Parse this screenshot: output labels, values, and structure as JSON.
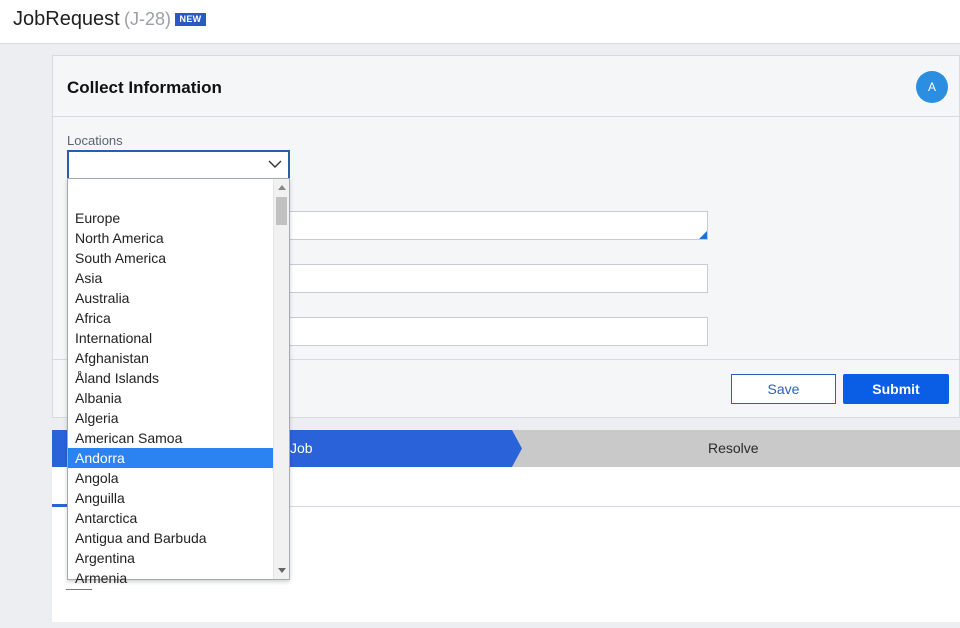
{
  "header": {
    "title": "JobRequest",
    "case_id": "(J-28)",
    "badge": "NEW"
  },
  "card": {
    "title": "Collect Information",
    "avatar_initial": "A",
    "locations_label": "Locations",
    "save_label": "Save",
    "submit_label": "Submit"
  },
  "stages": {
    "active": "Job",
    "next": "Resolve"
  },
  "dropdown": {
    "options": [
      "",
      "Europe",
      "North America",
      "South America",
      "Asia",
      "Australia",
      "Africa",
      "International",
      "Afghanistan",
      "Åland Islands",
      "Albania",
      "Algeria",
      "American Samoa",
      "Andorra",
      "Angola",
      "Anguilla",
      "Antarctica",
      "Antigua and Barbuda",
      "Argentina",
      "Armenia"
    ],
    "highlighted": "Andorra"
  },
  "colors": {
    "accent": "#0a5ee6",
    "stage_active": "#2a63d9",
    "selection": "#2a83f0",
    "avatar": "#2c8ee0"
  }
}
